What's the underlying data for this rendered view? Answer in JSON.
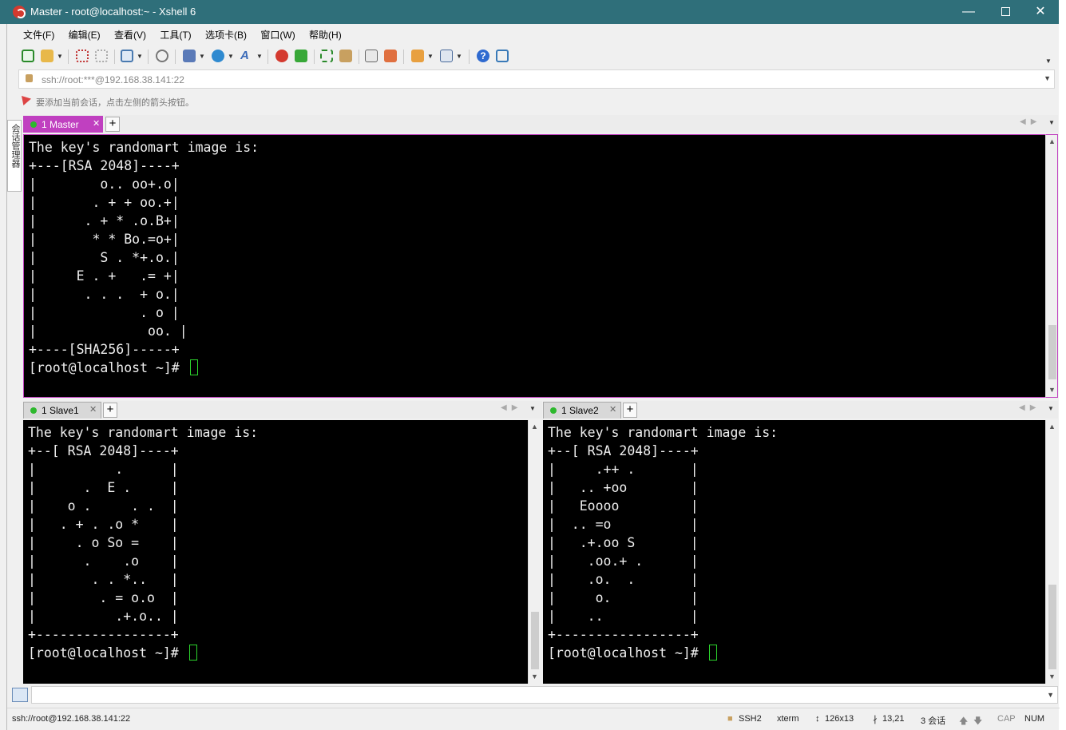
{
  "window": {
    "title": "Master - root@localhost:~ - Xshell 6"
  },
  "menu": [
    "文件(F)",
    "编辑(E)",
    "查看(V)",
    "工具(T)",
    "选项卡(B)",
    "窗口(W)",
    "帮助(H)"
  ],
  "address": {
    "value": "ssh://root:***@192.168.38.141:22"
  },
  "hint": "要添加当前会话，点击左侧的箭头按钮。",
  "side_tab": "会话管理器",
  "panes": {
    "master": {
      "tab_label": "1 Master",
      "lines": [
        "The key's randomart image is:",
        "+---[RSA 2048]----+",
        "|        o.. oo+.o|",
        "|       . + + oo.+|",
        "|      . + * .o.B+|",
        "|       * * Bo.=o+|",
        "|        S . *+.o.|",
        "|     E . +   .= +|",
        "|      . . .  + o.|",
        "|             . o |",
        "|              oo. |",
        "+----[SHA256]-----+",
        "[root@localhost ~]# "
      ]
    },
    "slave1": {
      "tab_label": "1 Slave1",
      "lines": [
        "The key's randomart image is:",
        "+--[ RSA 2048]----+",
        "|          .      |",
        "|      .  E .     |",
        "|    o .     . .  |",
        "|   . + . .o *    |",
        "|     . o So =    |",
        "|      .    .o    |",
        "|       . . *..   |",
        "|        . = o.o  |",
        "|          .+.o.. |",
        "+-----------------+",
        "[root@localhost ~]# "
      ]
    },
    "slave2": {
      "tab_label": "1 Slave2",
      "lines": [
        "The key's randomart image is:",
        "+--[ RSA 2048]----+",
        "|     .++ .       |",
        "|   .. +oo        |",
        "|   Eoooo         |",
        "|  .. =o          |",
        "|   .+.oo S       |",
        "|    .oo.+ .      |",
        "|    .o.  .       |",
        "|     o.          |",
        "|    ..           |",
        "+-----------------+",
        "[root@localhost ~]# "
      ]
    }
  },
  "status": {
    "connection": "ssh://root@192.168.38.141:22",
    "protocol": "SSH2",
    "terminal": "xterm",
    "size": "126x13",
    "position": "13,21",
    "sessions": "3 会话",
    "cap": "CAP",
    "num": "NUM"
  },
  "colors": {
    "titlebar": "#2f6f7a",
    "master_accent": "#c040c0",
    "cursor": "#2dd42d"
  }
}
